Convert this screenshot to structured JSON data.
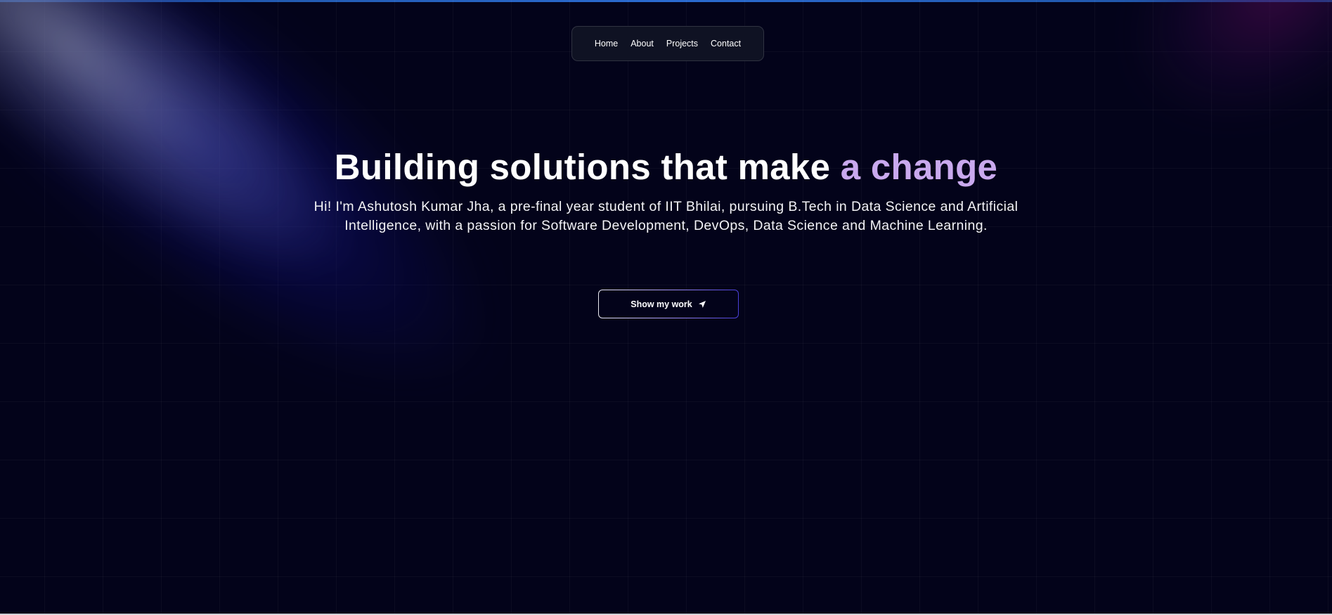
{
  "nav": {
    "items": [
      {
        "label": "Home"
      },
      {
        "label": "About"
      },
      {
        "label": "Projects"
      },
      {
        "label": "Contact"
      }
    ]
  },
  "hero": {
    "headline_main": "Building solutions that make ",
    "headline_accent": "a change",
    "subtitle": "Hi! I'm Ashutosh Kumar Jha, a pre-final year student of IIT Bhilai, pursuing B.Tech in Data Science and Artificial Intelligence, with a passion for Software Development, DevOps, Data Science and Machine Learning.",
    "cta_label": "Show my work",
    "cta_icon": "send-icon"
  },
  "colors": {
    "background": "#03031a",
    "accent": "#c9a9ee",
    "text": "#ffffff"
  }
}
